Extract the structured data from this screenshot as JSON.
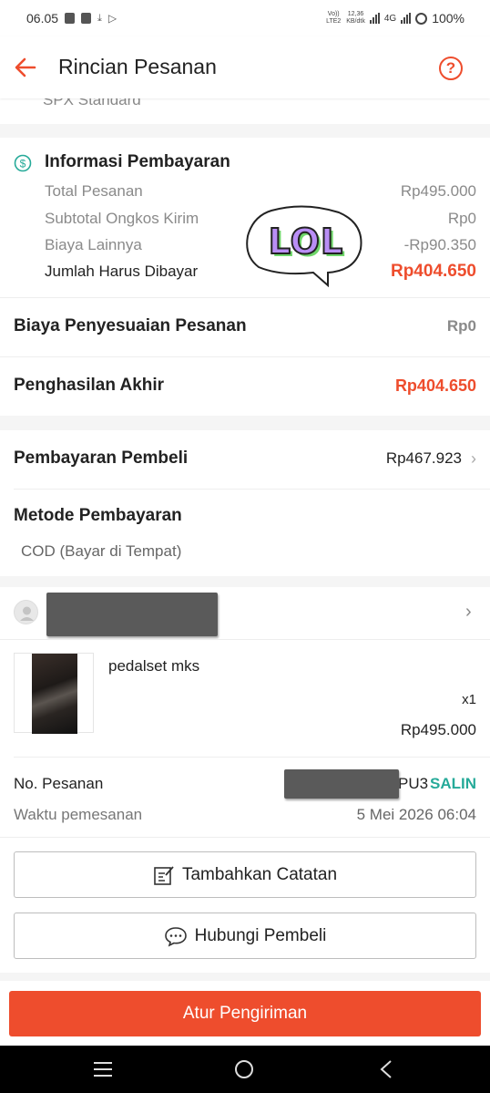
{
  "status_bar": {
    "time": "06.05",
    "net_line1": "Vo)) LTE2",
    "speed_value": "12,36",
    "speed_unit": "KB/dtk",
    "network": "4G",
    "battery": "100%"
  },
  "header": {
    "title": "Rincian Pesanan"
  },
  "shipping": {
    "service": "SPX Standard"
  },
  "payment_info": {
    "title": "Informasi Pembayaran",
    "rows": [
      {
        "label": "Total Pesanan",
        "value": "Rp495.000"
      },
      {
        "label": "Subtotal Ongkos Kirim",
        "value": "Rp0"
      },
      {
        "label": "Biaya Lainnya",
        "value": "-Rp90.350"
      }
    ],
    "total_label": "Jumlah Harus Dibayar",
    "total_value": "Rp404.650",
    "sticker_text": "LOL"
  },
  "adjustment": {
    "label": "Biaya Penyesuaian Pesanan",
    "value": "Rp0"
  },
  "final_income": {
    "label": "Penghasilan Akhir",
    "value": "Rp404.650"
  },
  "buyer_payment": {
    "label": "Pembayaran Pembeli",
    "value": "Rp467.923"
  },
  "payment_method": {
    "label": "Metode Pembayaran",
    "value": "COD (Bayar di Tempat)"
  },
  "product": {
    "name": "pedalset mks",
    "qty": "x1",
    "price": "Rp495.000"
  },
  "order": {
    "no_label": "No. Pesanan",
    "no_suffix": "PU3",
    "copy_label": "SALIN",
    "time_label": "Waktu pemesanan",
    "time_value": "5 Mei 2026 06:04"
  },
  "actions": {
    "add_note": "Tambahkan Catatan",
    "contact_buyer": "Hubungi Pembeli",
    "arrange_shipping": "Atur Pengiriman"
  },
  "colors": {
    "accent": "#ee4d2d",
    "teal": "#26aa99"
  }
}
